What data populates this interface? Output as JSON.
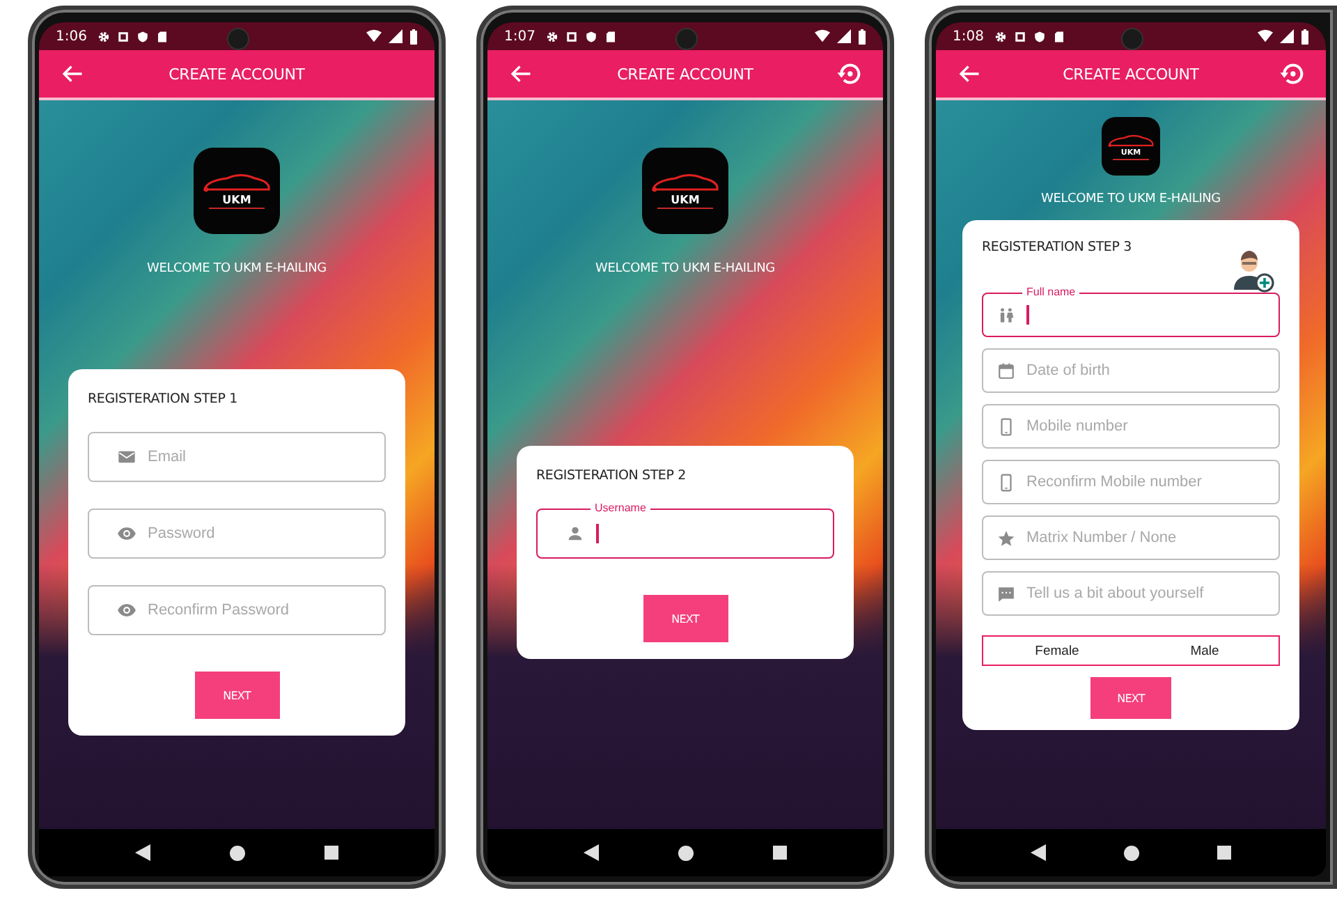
{
  "phones": [
    {
      "status": {
        "time": "1:06"
      },
      "appbar": {
        "title": "CREATE ACCOUNT",
        "reset_button": false
      },
      "logo": {
        "text": "UKM"
      },
      "welcome": "WELCOME TO UKM E-HAILING",
      "card": {
        "title": "REGISTERATION STEP 1",
        "profile_button": false,
        "fields": [
          {
            "kind": "email",
            "placeholder": "Email",
            "focused": false
          },
          {
            "kind": "password",
            "placeholder": "Password",
            "focused": false
          },
          {
            "kind": "password",
            "placeholder": "Reconfirm Password",
            "focused": false
          }
        ],
        "button": "NEXT"
      }
    },
    {
      "status": {
        "time": "1:07"
      },
      "appbar": {
        "title": "CREATE ACCOUNT",
        "reset_button": true
      },
      "logo": {
        "text": "UKM"
      },
      "welcome": "WELCOME TO UKM E-HAILING",
      "card": {
        "title": "REGISTERATION STEP 2",
        "profile_button": false,
        "fields": [
          {
            "kind": "username",
            "label": "Username",
            "focused": true
          }
        ],
        "button": "NEXT"
      }
    },
    {
      "status": {
        "time": "1:08"
      },
      "appbar": {
        "title": "CREATE ACCOUNT",
        "reset_button": true
      },
      "logo": {
        "text": "UKM"
      },
      "welcome": "WELCOME TO UKM E-HAILING",
      "card": {
        "title": "REGISTERATION STEP 3",
        "profile_button": true,
        "fields": [
          {
            "kind": "name",
            "label": "Full name",
            "focused": true
          },
          {
            "kind": "date",
            "placeholder": "Date of birth",
            "focused": false
          },
          {
            "kind": "mobile",
            "placeholder": "Mobile number",
            "focused": false
          },
          {
            "kind": "mobile",
            "placeholder": "Reconfirm Mobile number",
            "focused": false
          },
          {
            "kind": "matrix",
            "placeholder": "Matrix Number / None",
            "focused": false
          },
          {
            "kind": "about",
            "placeholder": "Tell us a bit about yourself",
            "focused": false
          }
        ],
        "gender_options": [
          "Female",
          "Male"
        ],
        "button": "NEXT"
      }
    }
  ]
}
